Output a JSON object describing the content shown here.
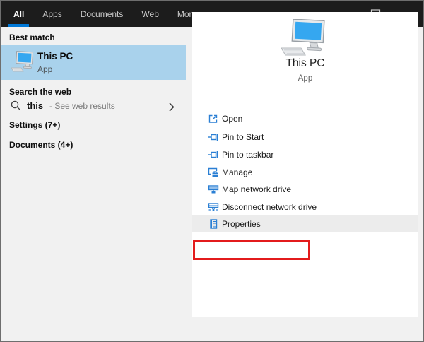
{
  "header": {
    "tabs": [
      {
        "label": "All",
        "active": true
      },
      {
        "label": "Apps",
        "active": false
      },
      {
        "label": "Documents",
        "active": false
      },
      {
        "label": "Web",
        "active": false
      },
      {
        "label": "More",
        "active": false,
        "has_dropdown": true
      }
    ]
  },
  "left_panel": {
    "best_match_header": "Best match",
    "best_match": {
      "title": "This PC",
      "subtitle": "App"
    },
    "search_web_header": "Search the web",
    "web_suggestion": {
      "query": "this",
      "hint": "- See web results"
    },
    "groups": [
      {
        "label": "Settings (7+)"
      },
      {
        "label": "Documents (4+)"
      }
    ]
  },
  "preview_panel": {
    "title": "This PC",
    "subtitle": "App",
    "actions": [
      {
        "label": "Open"
      },
      {
        "label": "Pin to Start"
      },
      {
        "label": "Pin to taskbar"
      },
      {
        "label": "Manage"
      },
      {
        "label": "Map network drive"
      },
      {
        "label": "Disconnect network drive"
      },
      {
        "label": "Properties",
        "highlighted": true
      }
    ],
    "annotation": {
      "type": "red-box",
      "target": "Properties"
    }
  },
  "colors": {
    "header_bg": "#1c1c1c",
    "accent_blue": "#0078d7",
    "selection_blue": "#a9d2ec",
    "icon_blue": "#2a7fd4",
    "annotation_red": "#e31b1c",
    "pane_bg": "#f1f1f1",
    "card_bg": "#ffffff",
    "hover_gray": "#ececec"
  }
}
